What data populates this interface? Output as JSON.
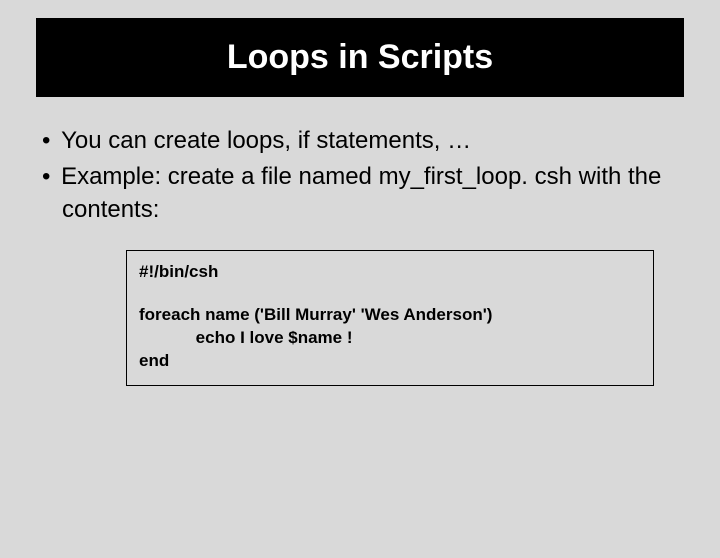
{
  "title": "Loops in Scripts",
  "bullets": [
    "You can create loops, if statements, …",
    "Example: create a file named my_first_loop. csh with the contents:"
  ],
  "code": {
    "line1": "#!/bin/csh",
    "line2": "foreach name ('Bill Murray' 'Wes Anderson')",
    "line3": "            echo I love $name !",
    "line4": "end"
  }
}
